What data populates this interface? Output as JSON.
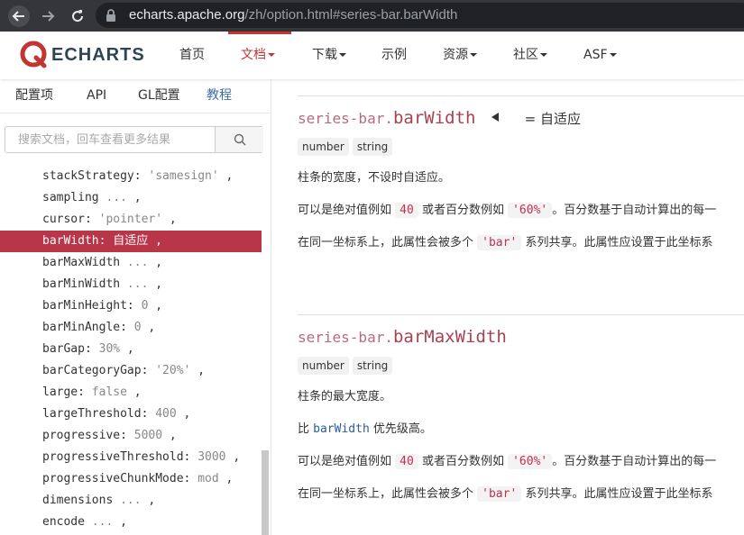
{
  "browser": {
    "url_host": "echarts.apache.org",
    "url_path": "/zh/option.html#series-bar.barWidth"
  },
  "navbar": {
    "logo_text": "ECHARTS",
    "items": [
      {
        "label": "首页",
        "dropdown": false
      },
      {
        "label": "文档",
        "dropdown": true
      },
      {
        "label": "下载",
        "dropdown": true
      },
      {
        "label": "示例",
        "dropdown": false
      },
      {
        "label": "资源",
        "dropdown": true
      },
      {
        "label": "社区",
        "dropdown": true
      },
      {
        "label": "ASF",
        "dropdown": true
      }
    ]
  },
  "sidebar": {
    "tabs": [
      "配置项",
      "API",
      "GL配置",
      "教程"
    ],
    "search_placeholder": "搜索文档，回车查看更多结果",
    "props": [
      {
        "key": "stackStrategy",
        "value": "'samesign'",
        "tail": " ,"
      },
      {
        "key": "sampling",
        "value": "...",
        "tail": " ,"
      },
      {
        "key": "cursor",
        "value": "'pointer'",
        "tail": " ,"
      },
      {
        "key": "barWidth",
        "value": "自适应",
        "tail": " ,"
      },
      {
        "key": "barMaxWidth",
        "value": "...",
        "tail": " ,"
      },
      {
        "key": "barMinWidth",
        "value": "...",
        "tail": " ,"
      },
      {
        "key": "barMinHeight",
        "value": "0",
        "tail": " ,"
      },
      {
        "key": "barMinAngle",
        "value": "0",
        "tail": " ,"
      },
      {
        "key": "barGap",
        "value": "30%",
        "tail": " ,"
      },
      {
        "key": "barCategoryGap",
        "value": "'20%'",
        "tail": " ,"
      },
      {
        "key": "large",
        "value": "false",
        "tail": " ,"
      },
      {
        "key": "largeThreshold",
        "value": "400",
        "tail": " ,"
      },
      {
        "key": "progressive",
        "value": "5000",
        "tail": " ,"
      },
      {
        "key": "progressiveThreshold",
        "value": "3000",
        "tail": " ,"
      },
      {
        "key": "progressiveChunkMode",
        "value": "mod",
        "tail": " ,"
      },
      {
        "key": "dimensions",
        "value": "...",
        "tail": " ,"
      },
      {
        "key": "encode",
        "value": "...",
        "tail": " ,"
      }
    ]
  },
  "main": {
    "section1": {
      "prefix": "series-bar.",
      "name": "barWidth",
      "default": "= 自适应",
      "types": [
        "number",
        "string"
      ],
      "desc": "柱条的宽度，不设时自适应。",
      "p2_a": "可以是绝对值例如",
      "p2_code1": "40",
      "p2_b": "或者百分数例如",
      "p2_code2": "'60%'",
      "p2_c": "。百分数基于自动计算出的每一",
      "p3_a": "在同一坐标系上，此属性会被多个",
      "p3_code": "'bar'",
      "p3_b": "系列共享。此属性应设置于此坐标系"
    },
    "section2": {
      "prefix": "series-bar.",
      "name": "barMaxWidth",
      "types": [
        "number",
        "string"
      ],
      "desc": "柱条的最大宽度。",
      "p2_a": "比",
      "p2_link": "barWidth",
      "p2_b": "优先级高。",
      "p3_a": "可以是绝对值例如",
      "p3_code1": "40",
      "p3_b": "或者百分数例如",
      "p3_code2": "'60%'",
      "p3_c": "。百分数基于自动计算出的每一",
      "p4_a": "在同一坐标系上，此属性会被多个",
      "p4_code": "'bar'",
      "p4_b": "系列共享。此属性应设置于此坐标系"
    }
  }
}
